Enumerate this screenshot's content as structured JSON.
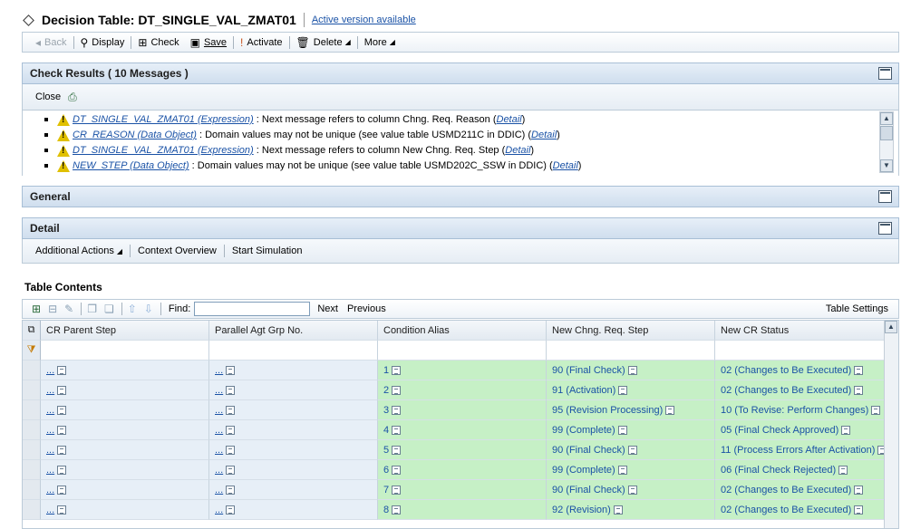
{
  "header": {
    "title": "Decision Table: DT_SINGLE_VAL_ZMAT01",
    "active_version_link": "Active version available"
  },
  "toolbar": {
    "back": "Back",
    "display": "Display",
    "check": "Check",
    "save": "Save",
    "activate": "Activate",
    "delete": "Delete",
    "more": "More"
  },
  "check_results": {
    "title": "Check Results ( 10 Messages )",
    "close": "Close",
    "messages": [
      {
        "link": "DT_SINGLE_VAL_ZMAT01 (Expression)",
        "text": ": Next message refers to column Chng. Req. Reason (",
        "detail": "Detail",
        "end": ")"
      },
      {
        "link": "CR_REASON (Data Object)",
        "text": ": Domain values may not be unique (see value table USMD211C in DDIC) (",
        "detail": "Detail",
        "end": ")"
      },
      {
        "link": "DT_SINGLE_VAL_ZMAT01 (Expression)",
        "text": ": Next message refers to column New Chng. Req. Step (",
        "detail": "Detail",
        "end": ")"
      },
      {
        "link": "NEW_STEP (Data Object)",
        "text": ": Domain values may not be unique (see value table USMD202C_SSW in DDIC) (",
        "detail": "Detail",
        "end": ")"
      }
    ]
  },
  "general": {
    "title": "General"
  },
  "detail": {
    "title": "Detail",
    "actions": [
      "Additional Actions",
      "Context Overview",
      "Start Simulation"
    ]
  },
  "table": {
    "section_title": "Table Contents",
    "find_label": "Find:",
    "find_value": "",
    "next": "Next",
    "previous": "Previous",
    "settings": "Table Settings",
    "columns": [
      "CR Parent Step",
      "Parallel Agt Grp No.",
      "Condition Alias",
      "New Chng. Req. Step",
      "New CR Status"
    ],
    "rows": [
      {
        "parent": "...",
        "agt": "...",
        "alias": "1",
        "step": "90 (Final Check)",
        "status": "02 (Changes to Be Executed)"
      },
      {
        "parent": "...",
        "agt": "...",
        "alias": "2",
        "step": "91 (Activation)",
        "status": "02 (Changes to Be Executed)"
      },
      {
        "parent": "...",
        "agt": "...",
        "alias": "3",
        "step": "95 (Revision Processing)",
        "status": "10 (To Revise: Perform Changes)"
      },
      {
        "parent": "...",
        "agt": "...",
        "alias": "4",
        "step": "99 (Complete)",
        "status": "05 (Final Check Approved)"
      },
      {
        "parent": "...",
        "agt": "...",
        "alias": "5",
        "step": "90 (Final Check)",
        "status": "11 (Process Errors After Activation)"
      },
      {
        "parent": "...",
        "agt": "...",
        "alias": "6",
        "step": "99 (Complete)",
        "status": "06 (Final Check Rejected)"
      },
      {
        "parent": "...",
        "agt": "...",
        "alias": "7",
        "step": "90 (Final Check)",
        "status": "02 (Changes to Be Executed)"
      },
      {
        "parent": "...",
        "agt": "...",
        "alias": "8",
        "step": "92 (Revision)",
        "status": "02 (Changes to Be Executed)"
      }
    ]
  },
  "colors": {
    "link": "#1a52a6",
    "condition_bg": "#c6f0c6",
    "input_bg": "#e7eff7",
    "panel_header": "#cfdeee"
  }
}
